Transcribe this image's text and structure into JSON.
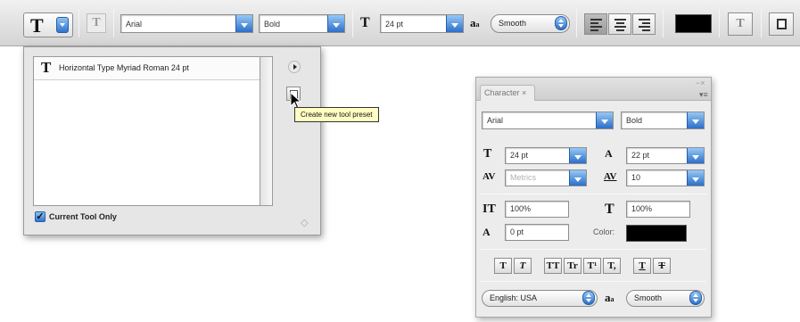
{
  "options_bar": {
    "tool_glyph": "T",
    "ghost_glyph": "T",
    "font_family": "Arial",
    "font_style": "Bold",
    "size_glyph": "T",
    "font_size": "24 pt",
    "aa_glyph": "a",
    "aa_sub": "a",
    "antialias": "Smooth",
    "text_color": "#000000",
    "warp_glyph": "T"
  },
  "preset_panel": {
    "preset_item": "Horizontal Type Myriad Roman 24 pt",
    "preset_glyph": "T",
    "current_tool_only": "Current Tool Only",
    "checkmark": "✓",
    "tooltip": "Create new tool preset"
  },
  "character_panel": {
    "tab_label": "Character ×",
    "font_family": "Arial",
    "font_style": "Bold",
    "font_size": "24 pt",
    "leading": "22 pt",
    "kerning": "Metrics",
    "tracking": "10",
    "vertical_scale": "100%",
    "horizontal_scale": "100%",
    "baseline_shift": "0 pt",
    "color_label": "Color:",
    "color_value": "#000000",
    "language": "English: USA",
    "antialias": "Smooth",
    "icons": {
      "size": "T",
      "leading": "A",
      "kerning": "AV",
      "tracking": "AV",
      "vscale": "IT",
      "hscale": "T",
      "baseline": "A",
      "aa": "a"
    },
    "format_buttons": [
      "T",
      "T",
      "TT",
      "Tr",
      "T¹",
      "T,",
      "T",
      "T"
    ]
  }
}
